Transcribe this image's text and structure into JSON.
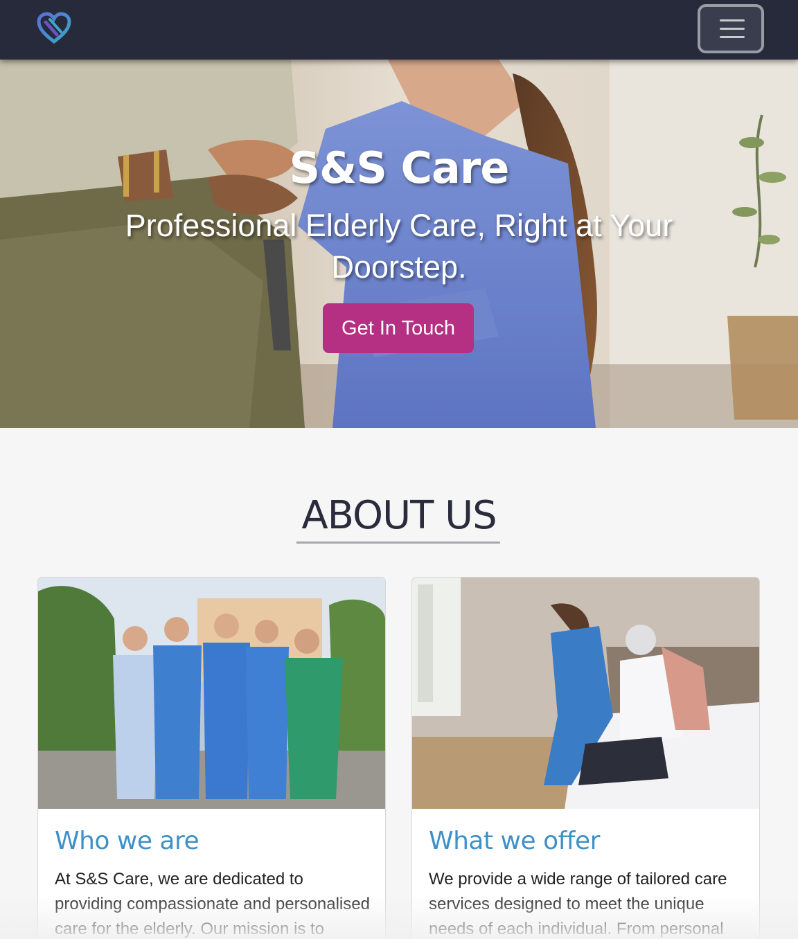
{
  "brand": {
    "logo_icon": "heart-logo-icon"
  },
  "navbar": {
    "menu_icon": "hamburger-menu-icon"
  },
  "hero": {
    "title": "S&S Care",
    "subtitle": "Professional Elderly Care, Right at Your Doorstep.",
    "cta_label": "Get In Touch",
    "cta_color": "#b52f82"
  },
  "about": {
    "heading": "ABOUT US",
    "cards": [
      {
        "title": "Who we are",
        "text": "At S&S Care, we are dedicated to providing compassionate and personalised care for the elderly. Our mission is to support"
      },
      {
        "title": "What we offer",
        "text": "We provide a wide range of tailored care services designed to meet the unique needs of each individual. From personal"
      }
    ]
  },
  "colors": {
    "navbar": "#272a3a",
    "accent": "#b52f82",
    "card_title": "#3e90c8",
    "page_bg": "#f6f6f6"
  }
}
